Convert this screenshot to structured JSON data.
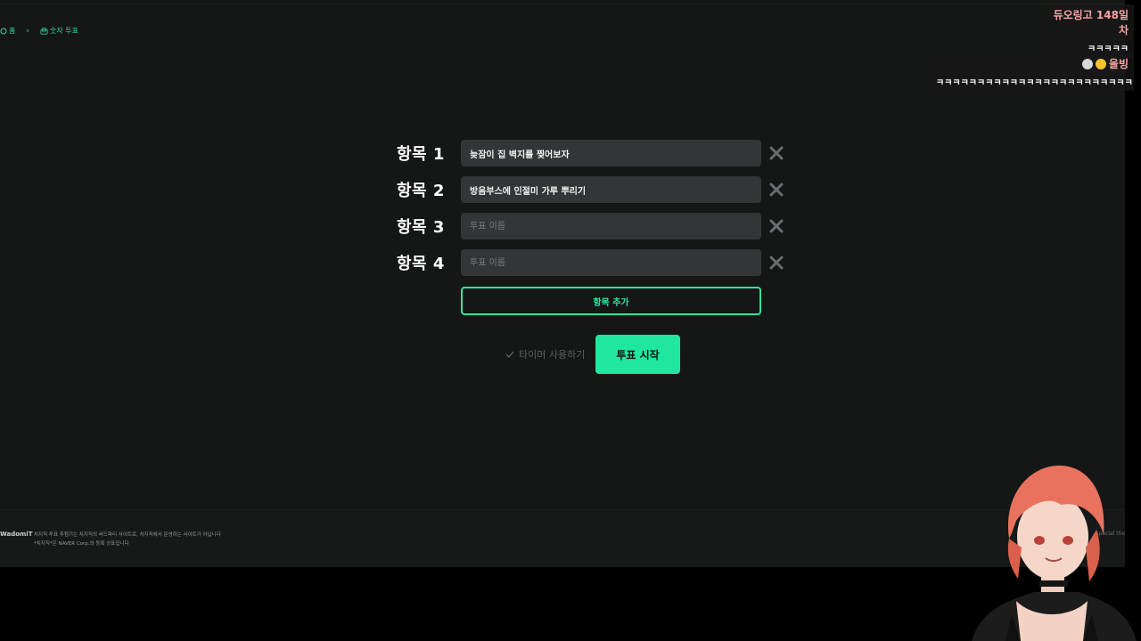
{
  "breadcrumb": {
    "home": "홈",
    "current": "숫자 투표"
  },
  "rows": [
    {
      "label": "항목 1",
      "value": "늦잠이 집 벽지를 찢어보자",
      "placeholder": "투표 이름"
    },
    {
      "label": "항목 2",
      "value": "방음부스에 인절미 가루 뿌리기",
      "placeholder": "투표 이름"
    },
    {
      "label": "항목 3",
      "value": "",
      "placeholder": "투표 이름"
    },
    {
      "label": "항목 4",
      "value": "",
      "placeholder": "투표 이름"
    }
  ],
  "add_button": "항목 추가",
  "timer_label": "타이머 사용하기",
  "start_button": "투표 시작",
  "footer": {
    "brand": "WadomiT",
    "line1": "치지직 투표 추첨기는 치지직의 써드파티 사이트로, 치지직에서 운영하는 사이트가 아닙니다",
    "line2": "*치지직*은 NAVER Corp.의 등록 상표입니다",
    "right": "Special thx"
  },
  "chat": [
    {
      "name": "듀오링고 148일차",
      "message": "ㅋㅋㅋㅋㅋ"
    },
    {
      "name": "율빙",
      "message": "ㅋㅋㅋㅋㅋㅋㅋㅋㅋㅋㅋㅋㅋㅋㅋㅋㅋㅋㅋㅋㅋㅋㅋㅋ"
    }
  ],
  "colors": {
    "accent": "#1fe6a0",
    "background": "#151616",
    "input": "#333536",
    "chat_name": "#f9a4a4"
  },
  "icons": {
    "home": "home-icon",
    "chevron": "chevron-right-icon",
    "vote": "vote-icon",
    "close": "close-icon",
    "check": "check-icon"
  }
}
